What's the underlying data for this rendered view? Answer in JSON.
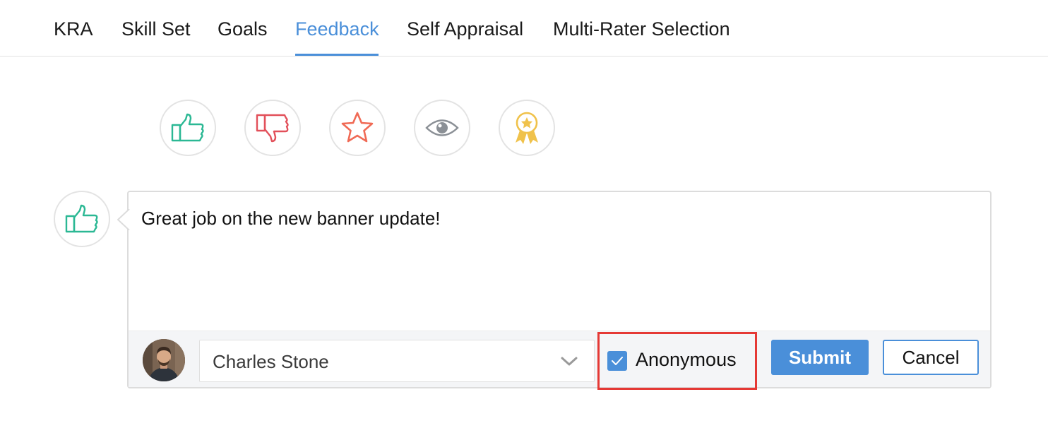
{
  "tabs": [
    {
      "label": "KRA",
      "active": false
    },
    {
      "label": "Skill Set",
      "active": false
    },
    {
      "label": "Goals",
      "active": false
    },
    {
      "label": "Feedback",
      "active": true
    },
    {
      "label": "Self Appraisal",
      "active": false
    },
    {
      "label": "Multi-Rater Selection",
      "active": false
    }
  ],
  "reactions": [
    {
      "icon": "thumbs-up-icon",
      "color": "#2bb894"
    },
    {
      "icon": "thumbs-down-icon",
      "color": "#e2505a"
    },
    {
      "icon": "star-icon",
      "color": "#f06a55"
    },
    {
      "icon": "eye-icon",
      "color": "#8b9096"
    },
    {
      "icon": "award-ribbon-icon",
      "color": "#f0c24b"
    }
  ],
  "feedback": {
    "selected_type_icon": "thumbs-up-icon",
    "message": "Great job on the new banner update!",
    "recipient": "Charles Stone",
    "anonymous_label": "Anonymous",
    "anonymous_checked": true,
    "submit_label": "Submit",
    "cancel_label": "Cancel"
  },
  "colors": {
    "accent": "#4a8fd9",
    "highlight_border": "#e53935"
  }
}
